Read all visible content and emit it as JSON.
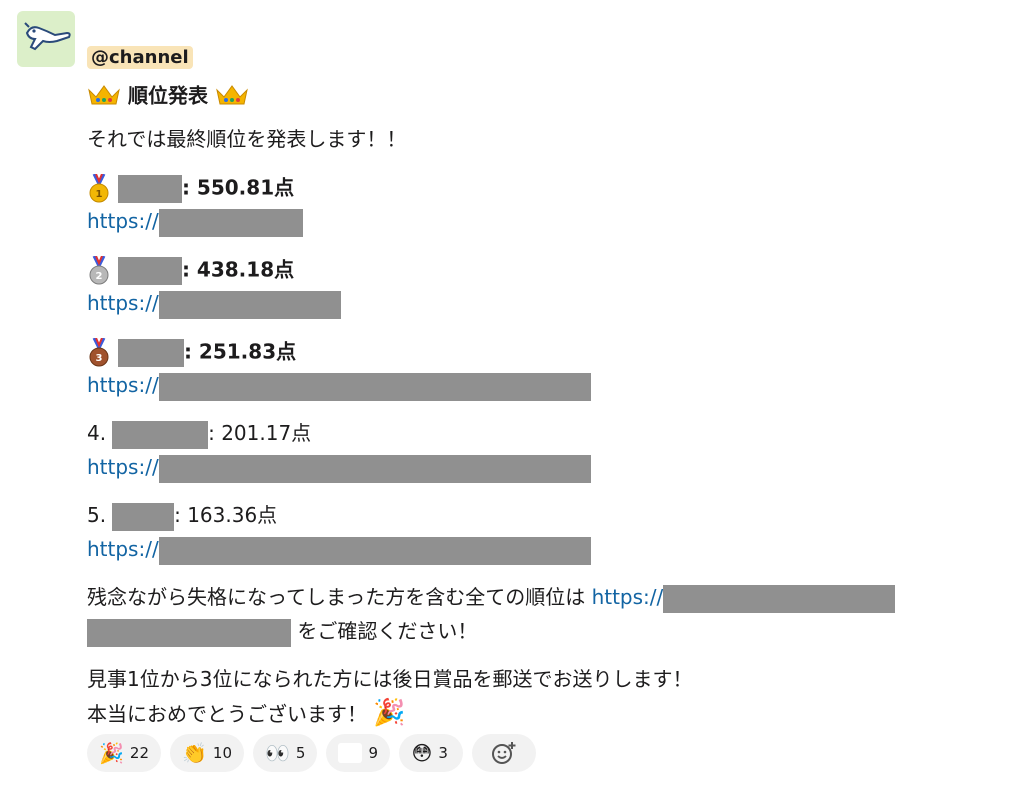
{
  "mention": "@channel",
  "title": "順位発表",
  "intro": "それでは最終順位を発表します！！",
  "ranking": [
    {
      "rank_label": "",
      "score": ": 550.81点",
      "link_prefix": "https://"
    },
    {
      "rank_label": "",
      "score": ": 438.18点",
      "link_prefix": "https://"
    },
    {
      "rank_label": "",
      "score": ": 251.83点",
      "link_prefix": "https://"
    },
    {
      "rank_label": "4.",
      "score": ": 201.17点",
      "link_prefix": "https://"
    },
    {
      "rank_label": "5.",
      "score": ": 163.36点",
      "link_prefix": "https://"
    }
  ],
  "notice": {
    "text": "残念ながら失格になってしまった方を含む全ての順位は",
    "link_prefix": "https://",
    "suffix": "をご確認ください！"
  },
  "closing": {
    "line1": "見事1位から3位になられた方には後日賞品を郵送でお送りします！",
    "line2": "本当におめでとうございます！"
  },
  "reactions": [
    {
      "icon": "party-popper-icon",
      "emoji": "🎉",
      "count": "22"
    },
    {
      "icon": "clapping-hands-icon",
      "emoji": "👏",
      "count": "10"
    },
    {
      "icon": "eyes-icon",
      "emoji": "👀",
      "count": "5"
    },
    {
      "icon": "blank-custom-emoji-icon",
      "emoji": "",
      "count": "9"
    },
    {
      "icon": "flushed-face-icon",
      "emoji": "😳",
      "count": "3"
    }
  ],
  "colors": {
    "link": "#1264a3",
    "mention_bg": "#f9e4b7",
    "redaction": "#909090",
    "reaction_bg": "#f2f2f2"
  }
}
